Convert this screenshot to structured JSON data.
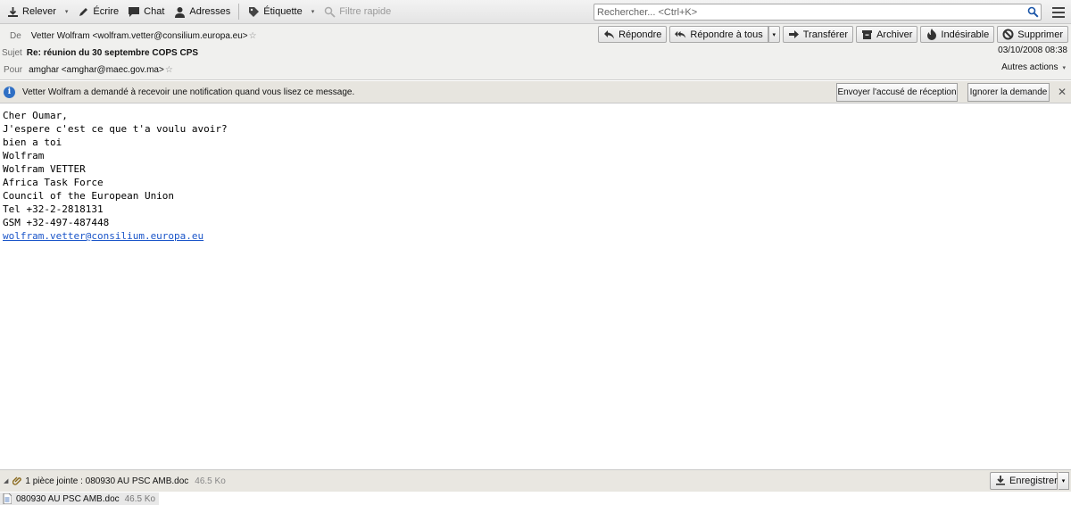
{
  "toolbar": {
    "relever": "Relever",
    "ecrire": "Écrire",
    "chat": "Chat",
    "adresses": "Adresses",
    "etiquette": "Étiquette",
    "filtre": "Filtre rapide",
    "search_placeholder": "Rechercher... <Ctrl+K>"
  },
  "header": {
    "from_label": "De",
    "from_value": "Vetter Wolfram <wolfram.vetter@consilium.europa.eu>",
    "subject_label": "Sujet",
    "subject_value": "Re: réunion du 30 septembre COPS CPS",
    "to_label": "Pour",
    "to_value": "amghar <amghar@maec.gov.ma>",
    "date": "03/10/2008 08:38",
    "more_actions": "Autres actions",
    "actions": {
      "reply": "Répondre",
      "reply_all": "Répondre à tous",
      "forward": "Transférer",
      "archive": "Archiver",
      "junk": "Indésirable",
      "delete": "Supprimer"
    }
  },
  "notification": {
    "message": "Vetter Wolfram a demandé à recevoir une notification quand vous lisez ce message.",
    "send_receipt": "Envoyer l'accusé de réception",
    "ignore": "Ignorer la demande"
  },
  "body": {
    "lines": [
      "Cher Oumar,",
      "J'espere c'est ce que t'a voulu avoir?",
      "bien a toi",
      "Wolfram",
      "Wolfram VETTER",
      "Africa Task Force",
      "Council of the European Union",
      "Tel +32-2-2818131",
      "GSM +32-497-487448"
    ],
    "email_link": "wolfram.vetter@consilium.europa.eu"
  },
  "attachments": {
    "summary": "1 pièce jointe : 080930 AU PSC AMB.doc",
    "summary_size": "46.5 Ko",
    "save_label": "Enregistrer",
    "items": [
      {
        "name": "080930 AU PSC AMB.doc",
        "size": "46.5 Ko"
      }
    ]
  },
  "colors": {
    "link": "#1a55c9",
    "info_icon": "#2f6fc4"
  }
}
